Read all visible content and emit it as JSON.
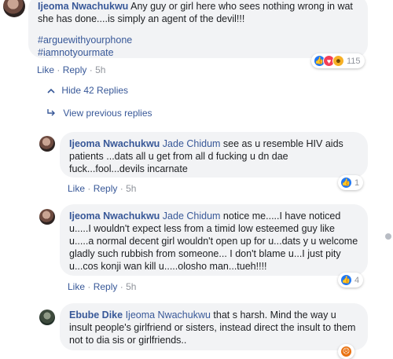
{
  "top_comment": {
    "author": "Ijeoma Nwachukwu",
    "text": "Any guy or girl here who sees nothing wrong in wat she has done....is simply an agent of the devil!!!",
    "hashtags": [
      "#arguewithyourphone",
      "#iamnotyourmate"
    ],
    "actions": {
      "like": "Like",
      "sep": "·",
      "reply": "Reply",
      "time": "5h"
    },
    "reaction_count": "115",
    "reaction_icons": [
      "like-icon",
      "love-icon",
      "haha-icon"
    ]
  },
  "hide_replies": {
    "icon": "chevron-up-icon",
    "label": "Hide 42 Replies"
  },
  "view_previous": {
    "icon": "reply-arrow-icon",
    "label": "View previous replies"
  },
  "replies": [
    {
      "author": "Ijeoma Nwachukwu",
      "mention": "Jade Chidum",
      "text": " see as u resemble HIV aids patients ...dats all u get from all d fucking u dn dae fuck...fool...devils incarnate",
      "actions": {
        "like": "Like",
        "sep": "·",
        "reply": "Reply",
        "time": "5h"
      },
      "reaction_count": "1",
      "reaction_icons": [
        "like-icon"
      ]
    },
    {
      "author": "Ijeoma Nwachukwu",
      "mention": "Jade Chidum",
      "text": " notice me.....I have noticed u.....I wouldn't expect less from a timid low esteemed guy like u.....a normal decent girl wouldn't open up for u...dats y u welcome gladly such rubbish from someone... I don't blame u...I just pity u...cos konji wan kill u.....olosho man...tueh!!!!",
      "actions": {
        "like": "Like",
        "sep": "·",
        "reply": "Reply",
        "time": "5h"
      },
      "reaction_count": "4",
      "reaction_icons": [
        "like-icon"
      ]
    },
    {
      "author": "Ebube Dike",
      "mention": "Ijeoma Nwachukwu",
      "text": " that s harsh. Mind the way u insult people's girlfriend or sisters, instead direct the insult to them not to dia sis or girlfriends..",
      "reaction_icons": [
        "angry-icon"
      ]
    }
  ],
  "colors": {
    "link": "#385898",
    "bubble": "#f2f3f5",
    "meta": "#90949c",
    "like": "#2078f4"
  }
}
